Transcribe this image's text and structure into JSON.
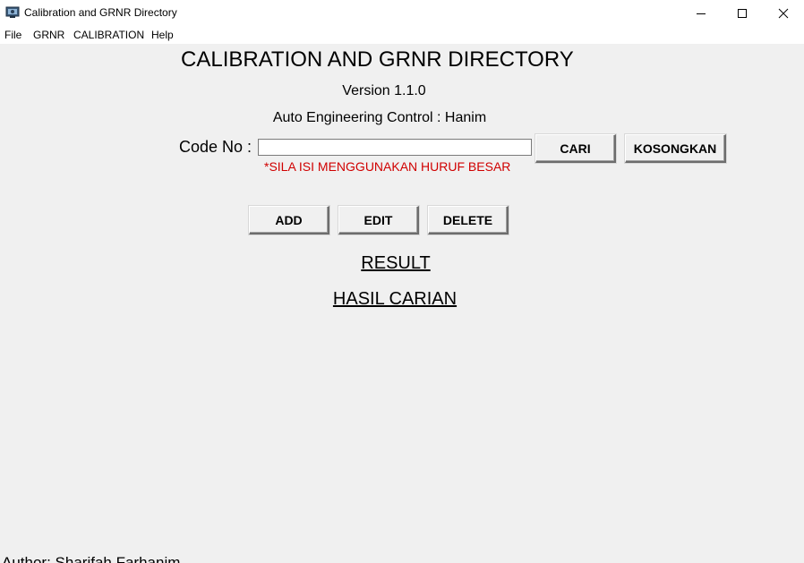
{
  "window": {
    "title": "Calibration and GRNR Directory"
  },
  "menu": {
    "file": "File",
    "grnr": "GRNR",
    "calibration": "CALIBRATION",
    "help": "Help"
  },
  "main": {
    "heading": "CALIBRATION AND GRNR DIRECTORY",
    "version": "Version 1.1.0",
    "control": "Auto Engineering Control : Hanim",
    "code_label": "Code No :",
    "code_value": "",
    "warning": "*SILA ISI MENGGUNAKAN HURUF BESAR",
    "result_label": "RESULT",
    "hasil_label": "HASIL CARIAN",
    "author": "Author: Sharifah Farhanim"
  },
  "buttons": {
    "cari": "CARI",
    "kosongkan": "KOSONGKAN",
    "add": "ADD",
    "edit": "EDIT",
    "delete": "DELETE"
  },
  "colors": {
    "background": "#f0f0f0",
    "warning": "#d00000"
  }
}
